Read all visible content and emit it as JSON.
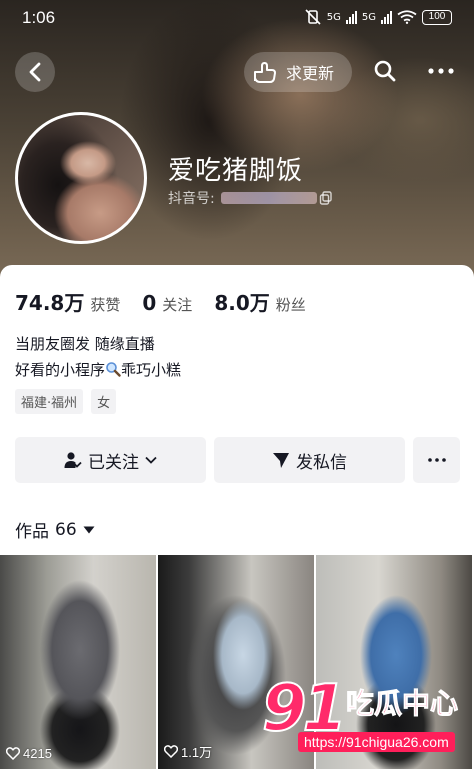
{
  "status_bar": {
    "time": "1:06",
    "network_1": "5G",
    "network_2": "5G",
    "battery": "100"
  },
  "header": {
    "update_label": "求更新",
    "name": "爱吃猪脚饭",
    "id_label": "抖音号:"
  },
  "stats": [
    {
      "value": "74.8万",
      "label": "获赞"
    },
    {
      "value": "0",
      "label": "关注"
    },
    {
      "value": "8.0万",
      "label": "粉丝"
    }
  ],
  "bio": {
    "line1": "当朋友圈发 随缘直播",
    "line2_prefix": "好看的小程序",
    "line2_suffix": "乖巧小糕"
  },
  "tags": [
    "福建·福州",
    "女"
  ],
  "actions": {
    "follow_label": "已关注",
    "message_label": "发私信"
  },
  "works": {
    "label": "作品",
    "count": "66",
    "items": [
      {
        "likes": "4215"
      },
      {
        "likes": "1.1万"
      },
      {
        "likes": ""
      }
    ]
  },
  "watermark": {
    "number": "91",
    "text": "吃瓜中心",
    "url": "https://91chigua26.com"
  },
  "colors": {
    "accent": "#ff2b6a",
    "card_bg": "#ffffff",
    "button_bg": "#f2f2f4"
  }
}
